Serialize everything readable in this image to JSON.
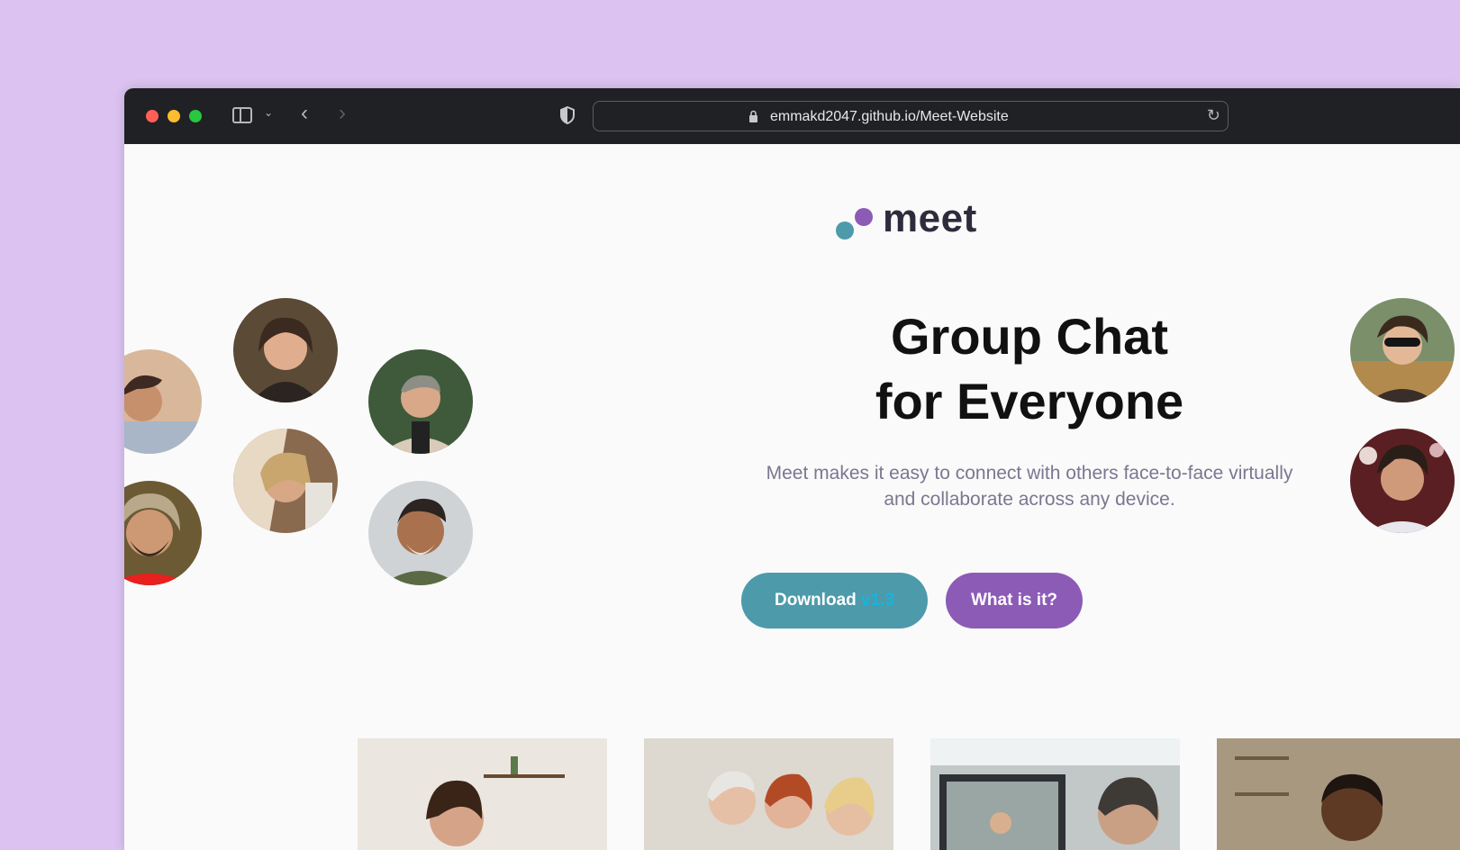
{
  "browser": {
    "url": "emmakd2047.github.io/Meet-Website"
  },
  "logo": {
    "text": "meet"
  },
  "hero": {
    "title_line1": "Group Chat",
    "title_line2": "for Everyone",
    "subtitle_line1": "Meet makes it easy to connect with others face-to-face virtually",
    "subtitle_line2": "and collaborate across any device."
  },
  "buttons": {
    "download_label": "Download",
    "download_version": "v1.3",
    "what_label": "What is it?"
  },
  "colors": {
    "brand_teal": "#4d9aaa",
    "brand_purple": "#8c5bb6",
    "background": "#dcc2f0"
  }
}
